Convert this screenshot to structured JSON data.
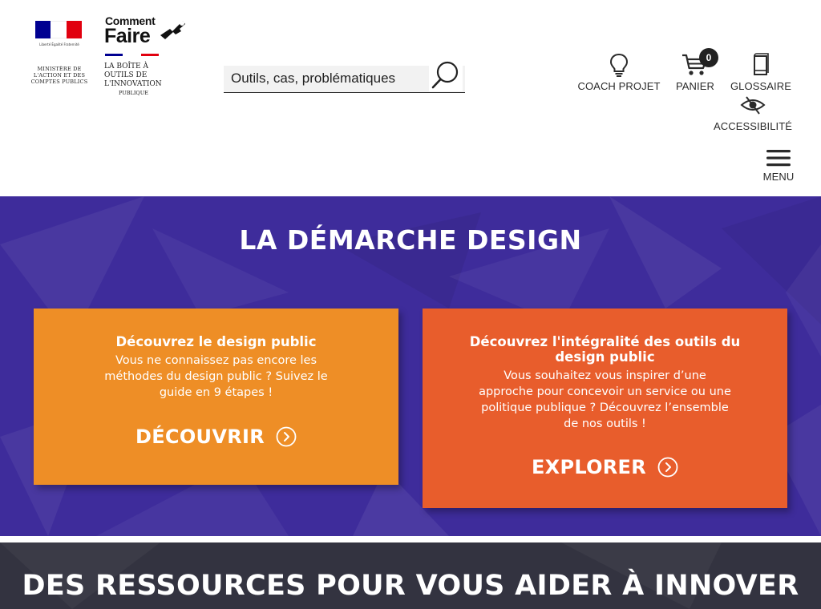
{
  "header": {
    "ministry": {
      "motto": "Liberté Égalité Fraternité",
      "name": "MINISTÈRE DE L'ACTION ET DES COMPTES PUBLICS"
    },
    "brand": {
      "line1": "Comment",
      "line2": "Faire",
      "tagline": "LA BOÎTE À OUTILS DE L'INNOVATION",
      "tagline_small": "PUBLIQUE",
      "colors": {
        "blue": "#000091",
        "white": "#ffffff",
        "red": "#e1000f"
      }
    },
    "search": {
      "placeholder": "Outils, cas, problématiques",
      "icon": "search-icon"
    },
    "nav": {
      "coach": {
        "label": "COACH PROJET",
        "icon": "lightbulb-icon"
      },
      "panier": {
        "label": "PANIER",
        "icon": "cart-icon",
        "count": "0"
      },
      "glossaire": {
        "label": "GLOSSAIRE",
        "icon": "book-icon"
      },
      "accessibilite": {
        "label": "ACCESSIBILITÉ",
        "icon": "eye-icon"
      },
      "menu": {
        "label": "MENU",
        "icon": "hamburger-icon"
      }
    }
  },
  "design_section": {
    "title": "LA DÉMARCHE DESIGN",
    "background": "#3e2c9b",
    "cards": [
      {
        "title": "Découvrez le design public",
        "text": "Vous ne connaissez pas encore les méthodes du design public ? Suivez le guide en 9 étapes !",
        "cta": "DÉCOUVRIR",
        "color": "#ee8e26"
      },
      {
        "title": "Découvrez l'intégralité des outils du design public",
        "text": "Vous souhaitez vous inspirer d’une approche pour concevoir un service ou une politique publique ? Découvrez l’ensemble de nos outils !",
        "cta": "EXPLORER",
        "color": "#e85d2c"
      }
    ]
  },
  "resources_section": {
    "title": "DES RESSOURCES POUR VOUS AIDER À INNOVER",
    "background": "#333340"
  }
}
